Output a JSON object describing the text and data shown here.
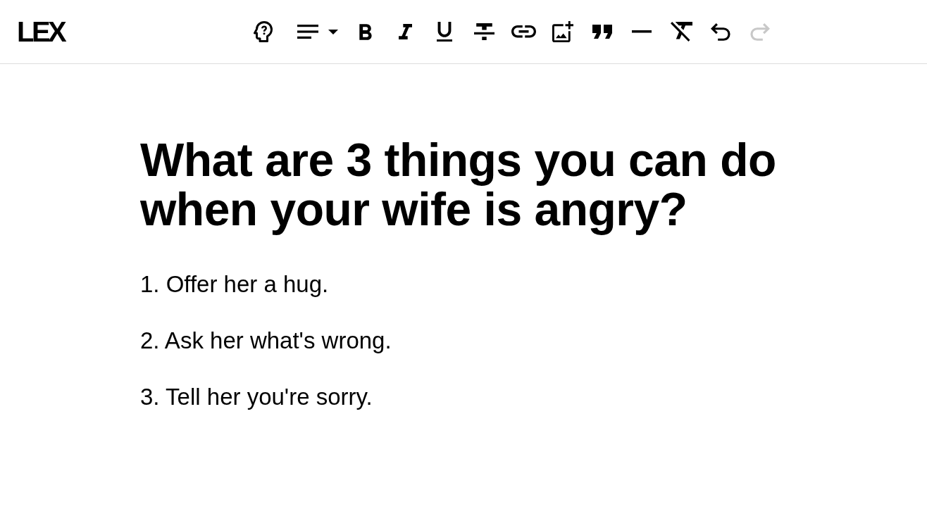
{
  "header": {
    "logo": "LEX",
    "toolbar": [
      {
        "kind": "help",
        "disabled": false
      },
      {
        "kind": "align",
        "disabled": false
      },
      {
        "kind": "bold",
        "disabled": false
      },
      {
        "kind": "italic",
        "disabled": false
      },
      {
        "kind": "underline",
        "disabled": false
      },
      {
        "kind": "strikethrough",
        "disabled": false
      },
      {
        "kind": "link",
        "disabled": false
      },
      {
        "kind": "image",
        "disabled": false
      },
      {
        "kind": "quote",
        "disabled": false
      },
      {
        "kind": "rule",
        "disabled": false
      },
      {
        "kind": "clear",
        "disabled": false
      },
      {
        "kind": "undo",
        "disabled": false
      },
      {
        "kind": "redo",
        "disabled": true
      }
    ]
  },
  "document": {
    "title": "What are 3 things you can do when your wife is angry?",
    "paragraphs": [
      "1. Offer her a hug.",
      "2. Ask her what's wrong.",
      "3. Tell her you're sorry."
    ]
  }
}
